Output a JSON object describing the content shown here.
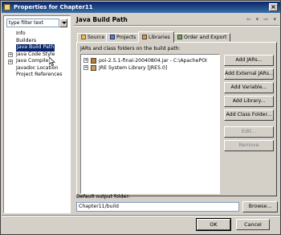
{
  "window": {
    "title": "Properties for Chapter11",
    "close_label": "×"
  },
  "sidebar": {
    "filter_text": "type filter text",
    "items": [
      {
        "label": "Info",
        "expandable": false,
        "selected": false
      },
      {
        "label": "Builders",
        "expandable": false,
        "selected": false
      },
      {
        "label": "Java Build Path",
        "expandable": false,
        "selected": true
      },
      {
        "label": "Java Code Style",
        "expandable": true,
        "selected": false
      },
      {
        "label": "Java Compiler",
        "expandable": true,
        "selected": false
      },
      {
        "label": "Javadoc Location",
        "expandable": false,
        "selected": false
      },
      {
        "label": "Project References",
        "expandable": false,
        "selected": false
      }
    ],
    "expand_glyph": "+"
  },
  "header": {
    "title": "Java Build Path",
    "nav_arrows": "⇦ ▾ ⇨ ▾"
  },
  "tabs": [
    {
      "label": "Source",
      "active": false
    },
    {
      "label": "Projects",
      "active": false
    },
    {
      "label": "Libraries",
      "active": true
    },
    {
      "label": "Order and Export",
      "active": false
    }
  ],
  "libraries": {
    "list_label": "JARs and class folders on the build path:",
    "entries": [
      {
        "label": "poi-2.5.1-final-20040804.jar - C:\\ApachePOI",
        "kind": "jar"
      },
      {
        "label": "JRE System Library [JRE5.0]",
        "kind": "library"
      }
    ],
    "buttons": [
      {
        "label": "Add JARs...",
        "enabled": true
      },
      {
        "label": "Add External JARs...",
        "enabled": true
      },
      {
        "label": "Add Variable...",
        "enabled": true
      },
      {
        "label": "Add Library...",
        "enabled": true
      },
      {
        "label": "Add Class Folder...",
        "enabled": true
      },
      {
        "label": "Edit...",
        "enabled": false
      },
      {
        "label": "Remove",
        "enabled": false
      }
    ]
  },
  "output": {
    "label": "Default output folder:",
    "value": "Chapter11/build",
    "browse_label": "Browse..."
  },
  "dialog": {
    "ok_label": "OK",
    "cancel_label": "Cancel"
  }
}
